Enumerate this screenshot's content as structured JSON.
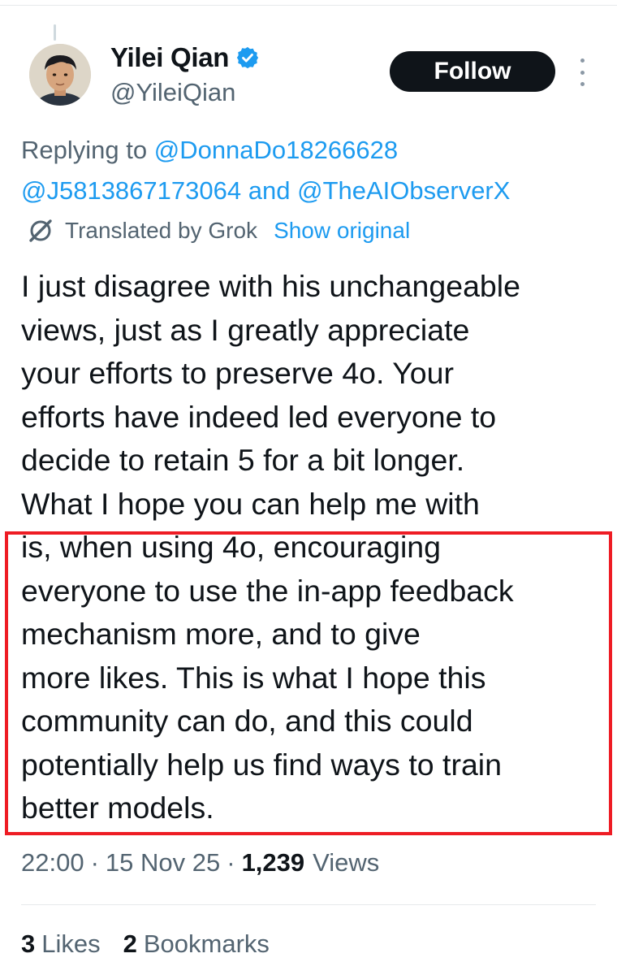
{
  "author": {
    "display_name": "Yilei Qian",
    "handle": "@YileiQian",
    "verified": true
  },
  "follow_label": "Follow",
  "reply_context": {
    "prefix": "Replying to",
    "mention_1": "@DonnaDo18266628",
    "mention_2": "@J5813867173064",
    "conjunction": "and",
    "mention_3": "@TheAIObserverX"
  },
  "translation": {
    "label": "Translated by Grok",
    "show_original_label": "Show original"
  },
  "tweet_lines": [
    "I just disagree with his unchangeable",
    "views, just as I greatly appreciate",
    "your efforts to preserve 4o. Your",
    "efforts have indeed led everyone to",
    "decide to retain 5 for a bit longer.",
    "What I hope you can help me with",
    "is, when using 4o, encouraging",
    "everyone to use the in-app feedback",
    "mechanism more, and to give",
    "more likes. This is what I hope this",
    "community can do, and this could",
    "potentially help us find ways to train",
    "better models."
  ],
  "meta": {
    "time": "22:00",
    "separator": "·",
    "date": "15 Nov 25",
    "views_count": "1,239",
    "views_label": "Views"
  },
  "stats": {
    "likes_count": "3",
    "likes_label": "Likes",
    "bookmarks_count": "2",
    "bookmarks_label": "Bookmarks"
  },
  "colors": {
    "link": "#1d9bf0",
    "secondary_text": "#536471",
    "primary_text": "#0f1419",
    "highlight_border": "#ee1c24",
    "verified_badge": "#1d9bf0"
  },
  "icons": {
    "verified": "verified-badge-icon",
    "more": "more-options-icon",
    "grok": "grok-translate-icon"
  }
}
